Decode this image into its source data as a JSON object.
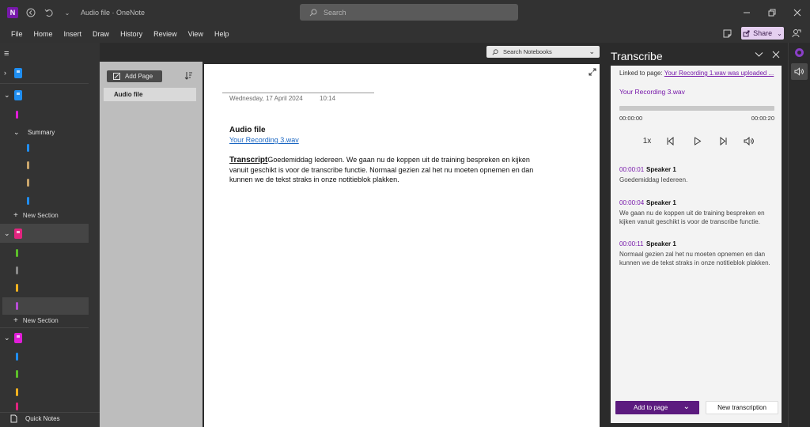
{
  "titlebar": {
    "app_badge": "N",
    "title": "Audio file  ·  OneNote",
    "search_placeholder": "Search"
  },
  "menu": {
    "items": [
      "File",
      "Home",
      "Insert",
      "Draw",
      "History",
      "Review",
      "View",
      "Help"
    ],
    "share_label": "Share"
  },
  "search_notebooks": {
    "placeholder": "Search Notebooks"
  },
  "nav": {
    "new_section_label": "New Section",
    "summary_label": "Summary",
    "quick_notes_label": "Quick Notes",
    "colors": {
      "blue": "#1f8ef1",
      "pink": "#e2247f",
      "magenta": "#e01ed8",
      "purple": "#b84dd6",
      "green": "#5cbf2a",
      "tan": "#c9a56b",
      "gray": "#8a8a8a",
      "yellow": "#f1b21f"
    }
  },
  "pagelist": {
    "add_page_label": "Add Page",
    "pages": [
      "Audio file"
    ]
  },
  "page": {
    "date": "Wednesday, 17 April 2024",
    "time": "10:14",
    "title": "Audio file",
    "link": "Your Recording 3.wav",
    "transcript_label": "Transcript",
    "transcript_text": "Goedemiddag Iedereen. We gaan nu de koppen uit de training bespreken en kijken vanuit geschikt is voor de transcribe functie. Normaal gezien zal het nu moeten opnemen en dan kunnen we de tekst straks in onze notitieblok plakken."
  },
  "transcribe": {
    "title": "Transcribe",
    "linked_prefix": "Linked to page: ",
    "linked_link": "Your Recording 1.wav was uploaded ...",
    "recording_name": "Your Recording 3.wav",
    "time_start": "00:00:00",
    "time_end": "00:00:20",
    "progress": 0,
    "speed": "1x",
    "segments": [
      {
        "time": "00:00:01",
        "speaker": "Speaker 1",
        "text": "Goedemiddag Iedereen."
      },
      {
        "time": "00:00:04",
        "speaker": "Speaker 1",
        "text": "We gaan nu de koppen uit de training bespreken en kijken vanuit geschikt is voor de transcribe functie."
      },
      {
        "time": "00:00:11",
        "speaker": "Speaker 1",
        "text": "Normaal gezien zal het nu moeten opnemen en dan kunnen we de tekst straks in onze notitieblok plakken."
      }
    ],
    "add_to_page_label": "Add to page",
    "new_transcription_label": "New transcription"
  },
  "accent": "#7719aa"
}
